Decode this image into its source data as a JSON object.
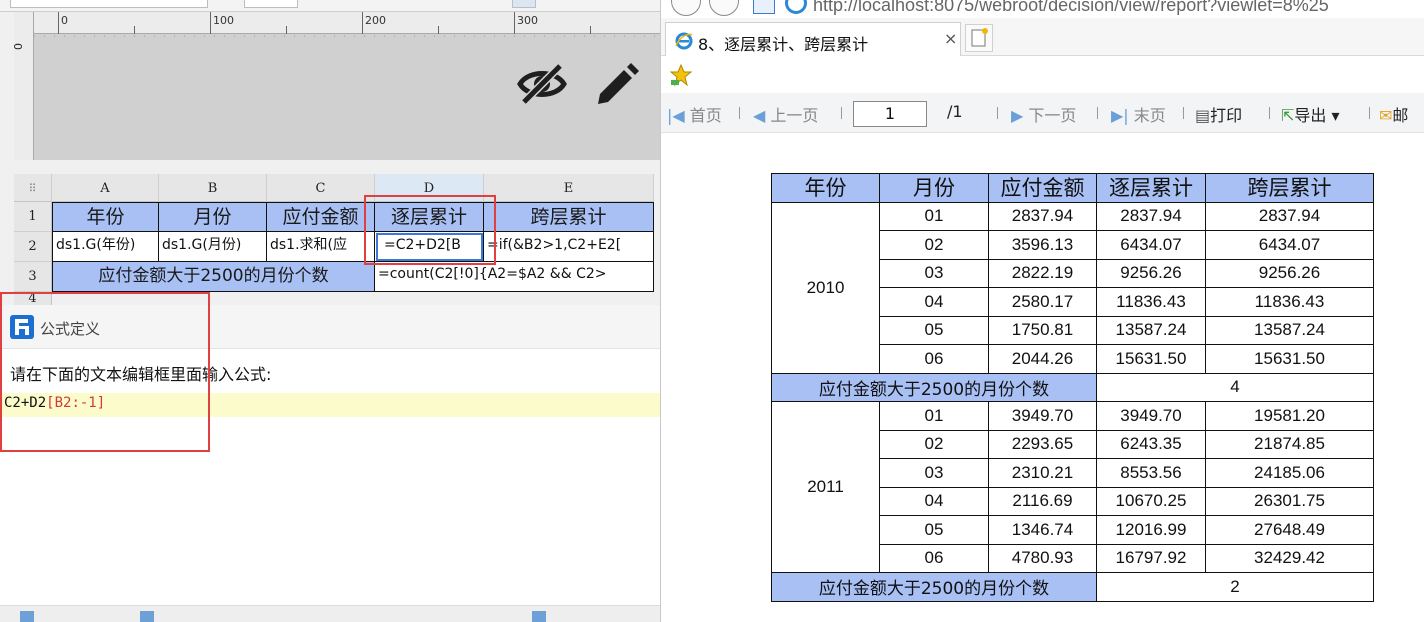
{
  "designer": {
    "ruler_ticks": [
      "0",
      "100",
      "200",
      "300"
    ],
    "column_headers": [
      "A",
      "B",
      "C",
      "D",
      "E"
    ],
    "row_headers": [
      "1",
      "2",
      "3",
      "4"
    ],
    "row1": [
      "年份",
      "月份",
      "应付金额",
      "逐层累计",
      "跨层累计"
    ],
    "row2": [
      "ds1.G(年份)",
      "ds1.G(月份)",
      "ds1.求和(应",
      "=C2+D2[B",
      "=if(&B2>1,C2+E2["
    ],
    "row3_merged": "应付金额大于2500的月份个数",
    "row3_formula": "=count(C2[!0]{A2=$A2 && C2>",
    "colors": {
      "header_bg": "#a8c0f4",
      "highlight_red": "#e04040"
    }
  },
  "dialog": {
    "title": "公式定义",
    "prompt": "请在下面的文本编辑框里面输入公式:",
    "formula_part1": "C2+D2",
    "formula_part2": "[B2:-1]"
  },
  "browser": {
    "address": "http://localhost:8075/webroot/decision/view/report?viewlet=8%25",
    "tab_title": "8、逐层累计、跨层累计",
    "tab_close": "×",
    "toolbar": {
      "first": "首页",
      "prev": "上一页",
      "page_value": "1",
      "total": "/1",
      "next": "下一页",
      "last": "末页",
      "print": "打印",
      "export": "导出",
      "mail": "邮"
    }
  },
  "report": {
    "headers": [
      "年份",
      "月份",
      "应付金额",
      "逐层累计",
      "跨层累计"
    ],
    "groups": [
      {
        "year": "2010",
        "rows": [
          [
            "01",
            "2837.94",
            "2837.94",
            "2837.94"
          ],
          [
            "02",
            "3596.13",
            "6434.07",
            "6434.07"
          ],
          [
            "03",
            "2822.19",
            "9256.26",
            "9256.26"
          ],
          [
            "04",
            "2580.17",
            "11836.43",
            "11836.43"
          ],
          [
            "05",
            "1750.81",
            "13587.24",
            "13587.24"
          ],
          [
            "06",
            "2044.26",
            "15631.50",
            "15631.50"
          ]
        ],
        "summary_label": "应付金额大于2500的月份个数",
        "summary_value": "4"
      },
      {
        "year": "2011",
        "rows": [
          [
            "01",
            "3949.70",
            "3949.70",
            "19581.20"
          ],
          [
            "02",
            "2293.65",
            "6243.35",
            "21874.85"
          ],
          [
            "03",
            "2310.21",
            "8553.56",
            "24185.06"
          ],
          [
            "04",
            "2116.69",
            "10670.25",
            "26301.75"
          ],
          [
            "05",
            "1346.74",
            "12016.99",
            "27648.49"
          ],
          [
            "06",
            "4780.93",
            "16797.92",
            "32429.42"
          ]
        ],
        "summary_label": "应付金额大于2500的月份个数",
        "summary_value": "2"
      }
    ]
  }
}
